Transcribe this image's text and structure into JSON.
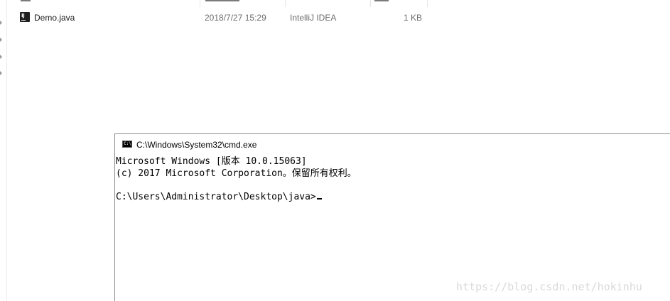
{
  "explorer": {
    "file": {
      "name": "Demo.java",
      "date_modified": "2018/7/27 15:29",
      "type": "IntelliJ IDEA",
      "size": "1 KB",
      "icon": "intellij-idea-file-icon"
    }
  },
  "cmd": {
    "title": "C:\\Windows\\System32\\cmd.exe",
    "icon": "cmd-icon",
    "lines": [
      "Microsoft Windows [版本 10.0.15063]",
      "(c) 2017 Microsoft Corporation。保留所有权利。",
      "",
      "C:\\Users\\Administrator\\Desktop\\java>"
    ]
  },
  "watermark": "https://blog.csdn.net/hokinhu"
}
